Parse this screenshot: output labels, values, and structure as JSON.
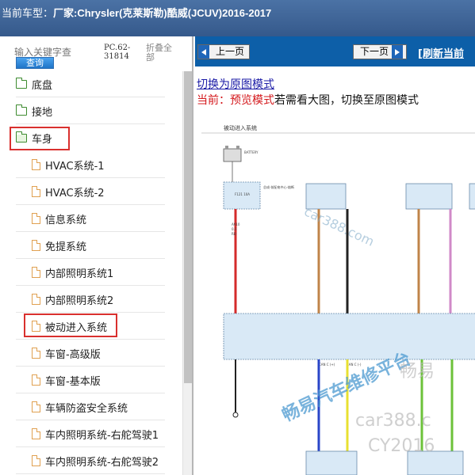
{
  "header": {
    "prefix": "当前车型：",
    "model": "厂家:Chrysler(克莱斯勒)酷威(JCUV)2016-2017"
  },
  "search": {
    "placeholder": "输入关键字查",
    "query_label": "查询",
    "pc_code": "PC.62-31814",
    "collapse_label": "折叠全部"
  },
  "tree": {
    "folders": [
      {
        "label": "底盘"
      },
      {
        "label": "接地"
      },
      {
        "label": "车身"
      }
    ],
    "files": [
      {
        "label": "HVAC系统-1"
      },
      {
        "label": "HVAC系统-2"
      },
      {
        "label": "信息系统"
      },
      {
        "label": "免提系统"
      },
      {
        "label": "内部照明系统1"
      },
      {
        "label": "内部照明系统2"
      },
      {
        "label": "被动进入系统"
      },
      {
        "label": "车窗-高级版"
      },
      {
        "label": "车窗-基本版"
      },
      {
        "label": "车辆防盗安全系统"
      },
      {
        "label": "车内照明系统-右舵驾驶1"
      },
      {
        "label": "车内照明系统-右舵驾驶2"
      }
    ]
  },
  "toolbar": {
    "prev_label": "上一页",
    "next_label": "下一页",
    "refresh_label": "[刷新当前"
  },
  "content": {
    "switch_link": "切换为原图模式",
    "status_prefix": "当前：预览模式",
    "status_suffix": "若需看大图，切换至原图模式"
  },
  "diagram": {
    "title": "被动进入系统",
    "battery": "BATTERY",
    "fuse_box": "总成-前配电中心-熔断",
    "fuse_id": "F121 10A",
    "wires_left": [
      "A910",
      "0.5",
      "RD"
    ],
    "colors": {
      "red": "#d42b2b",
      "brown": "#c0844a",
      "black": "#222222",
      "pink": "#d08ac8",
      "blue": "#2a46c8",
      "yellow": "#e8e030",
      "green": "#6cc23a",
      "module": "#d9e9f6"
    },
    "watermarks": [
      "car388.com",
      "畅易汽车维修平台",
      "畅易",
      "car388.c",
      "CY2016"
    ],
    "can_labels": [
      "CAN C (+)",
      "CAN C (-)"
    ]
  }
}
